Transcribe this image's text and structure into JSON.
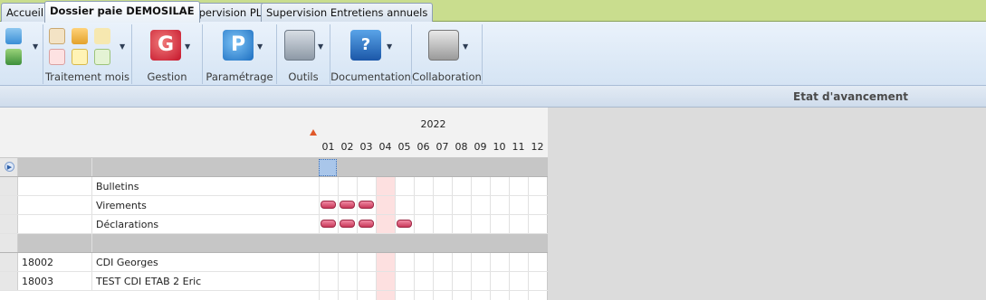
{
  "tabs": [
    {
      "label": "Accueil",
      "active": false
    },
    {
      "label": "Dossier paie DEMOSILAE",
      "active": true
    },
    {
      "label": "Supervision PL",
      "active": false
    },
    {
      "label": "Supervision Entretiens annuels",
      "active": false
    }
  ],
  "ribbon": {
    "groups": [
      {
        "label": ""
      },
      {
        "label": "Traitement mois"
      },
      {
        "label": "Gestion"
      },
      {
        "label": "Paramétrage"
      },
      {
        "label": "Outils"
      },
      {
        "label": "Documentation"
      },
      {
        "label": "Collaboration"
      }
    ]
  },
  "status": {
    "title": "Etat d'avancement"
  },
  "grid": {
    "year": "2022",
    "months": [
      "01",
      "02",
      "03",
      "04",
      "05",
      "06",
      "07",
      "08",
      "09",
      "10",
      "11",
      "12"
    ],
    "current_month": "04",
    "rows": [
      {
        "code": "",
        "label": "",
        "type": "group",
        "marks": []
      },
      {
        "code": "",
        "label": "Bulletins",
        "type": "item",
        "marks": []
      },
      {
        "code": "",
        "label": "Virements",
        "type": "item",
        "marks": [
          "01",
          "02",
          "03"
        ]
      },
      {
        "code": "",
        "label": "Déclarations",
        "type": "item",
        "marks": [
          "01",
          "02",
          "03",
          "05"
        ]
      },
      {
        "code": "",
        "label": "",
        "type": "group",
        "marks": []
      },
      {
        "code": "18002",
        "label": "CDI Georges",
        "type": "item",
        "marks": []
      },
      {
        "code": "18003",
        "label": "TEST CDI ETAB 2 Eric",
        "type": "item",
        "marks": []
      }
    ]
  }
}
